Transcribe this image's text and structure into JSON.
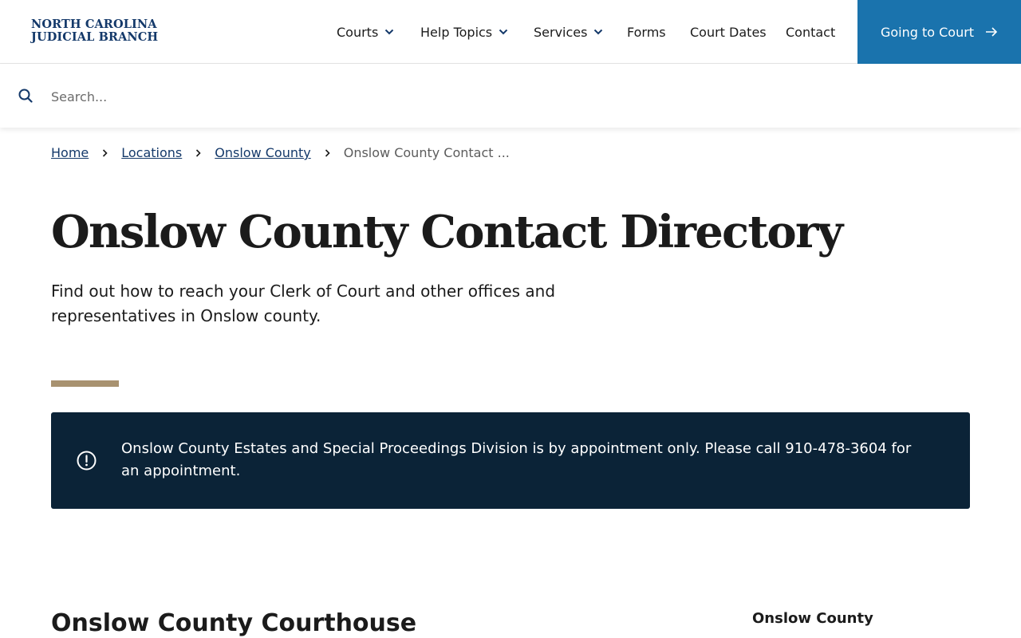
{
  "header": {
    "logo_line1": "NORTH CAROLINA",
    "logo_line2": "JUDICIAL BRANCH",
    "nav": [
      {
        "label": "Courts",
        "has_dropdown": true
      },
      {
        "label": "Help Topics",
        "has_dropdown": true
      },
      {
        "label": "Services",
        "has_dropdown": true
      },
      {
        "label": "Forms",
        "has_dropdown": false
      },
      {
        "label": "Court Dates",
        "has_dropdown": false
      },
      {
        "label": "Contact",
        "has_dropdown": false
      }
    ],
    "cta_label": "Going to Court",
    "cta_icon": "arrow-right-icon"
  },
  "search": {
    "placeholder": "Search...",
    "value": "",
    "icon": "search-icon"
  },
  "breadcrumb": {
    "items": [
      "Home",
      "Locations",
      "Onslow County"
    ],
    "current": "Onslow County Contact ..."
  },
  "page": {
    "title": "Onslow County Contact Directory",
    "intro": "Find out how to reach your Clerk of Court and other offices and representatives in Onslow county."
  },
  "alert": {
    "icon": "alert-circle-icon",
    "text": "Onslow County Estates and Special Proceedings Division is by appointment only. Please call 910-478-3604 for an appointment."
  },
  "section": {
    "title": "Onslow County Courthouse",
    "side_heading": "Onslow County"
  },
  "colors": {
    "brand_navy": "#14396a",
    "cta_blue": "#1a73ad",
    "alert_bg": "#0b2337",
    "accent_gold": "#a89270"
  }
}
